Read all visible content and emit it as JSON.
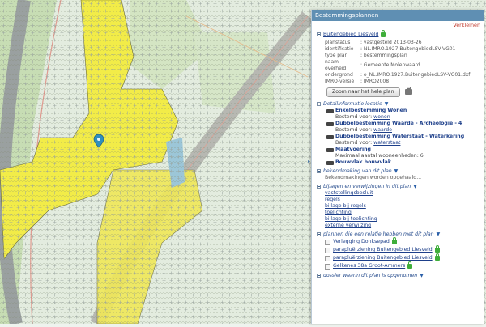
{
  "panel": {
    "title": "Bestemmingsplannen",
    "collapse_label": "Verkleinen",
    "plan": {
      "name": "Buitengebied Liesveld",
      "props": [
        {
          "key": "planstatus",
          "value": ": vastgesteld 2013-03-26"
        },
        {
          "key": "identificatie",
          "value": ": NL.IMRO.1927.BuitengebiedLSV-VG01"
        },
        {
          "key": "type plan",
          "value": ": bestemmingsplan"
        },
        {
          "key": "naam overheid",
          "value": ": Gemeente Molenwaard"
        },
        {
          "key": "ondergrond",
          "value": ": o_NL.IMRO.1927.BuitengebiedLSV-VG01.dxf"
        },
        {
          "key": "IMRO-versie",
          "value": ": IMRO2008"
        }
      ],
      "zoom_button": "Zoom naar het hele plan"
    },
    "detail": {
      "title": "Detailinformatie locatie",
      "items": [
        {
          "title": "Enkelbestemming Wonen",
          "sub_prefix": "Bestemd voor:",
          "sub_link": "wonen"
        },
        {
          "title": "Dubbelbestemming Waarde - Archeologie - 4",
          "sub_prefix": "Bestemd voor:",
          "sub_link": "waarde"
        },
        {
          "title": "Dubbelbestemming Waterstaat - Waterkering",
          "sub_prefix": "Bestemd voor:",
          "sub_link": "waterstaat"
        },
        {
          "title": "Maatvoering",
          "sub_prefix": "Maximaal aantal wooneenheden: 6",
          "sub_link": ""
        },
        {
          "title": "Bouwvlak bouwvlak",
          "sub_prefix": "",
          "sub_link": ""
        }
      ]
    },
    "bekendmaking": {
      "title": "bekendmaking van dit plan",
      "text": "Bekendmakingen worden opgehaald..."
    },
    "bijlagen": {
      "title": "bijlagen en verwijzingen in dit plan",
      "links": [
        "vaststellingsbesluit",
        "regels",
        "bijlage bij regels",
        "toelichting",
        "bijlage bij toelichting",
        "externe verwijzing"
      ]
    },
    "related": {
      "title": "plannen die een relatie hebben met dit plan",
      "items": [
        "Verlegging Donksepad",
        "parapluërziening Buitengebied Liesveld",
        "parapluërziening Buitengebied Liesveld",
        "Gelkenes 38a Groot-Ammers"
      ]
    },
    "dossier": {
      "title": "dossier waarin dit plan is opgenomen"
    }
  },
  "colors": {
    "header": "#5f8fb3",
    "yellow_zone": "#f2ec48",
    "green_zone": "#d9e6c5",
    "link": "#1d3f8a"
  }
}
